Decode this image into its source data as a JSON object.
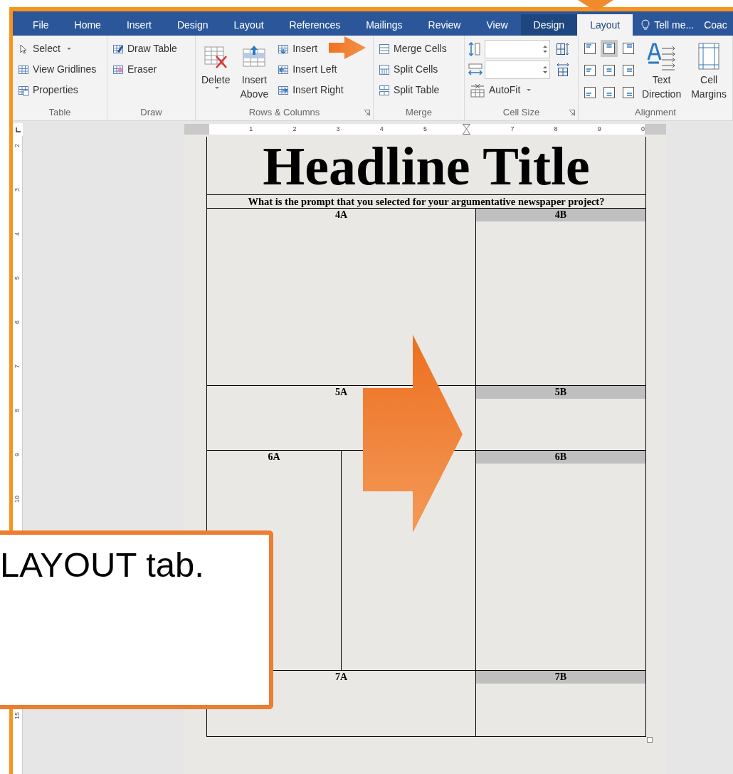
{
  "tabs": [
    {
      "label": "File",
      "selected": false,
      "contextual": false
    },
    {
      "label": "Home",
      "selected": false,
      "contextual": false
    },
    {
      "label": "Insert",
      "selected": false,
      "contextual": false
    },
    {
      "label": "Design",
      "selected": false,
      "contextual": false
    },
    {
      "label": "Layout",
      "selected": false,
      "contextual": false
    },
    {
      "label": "References",
      "selected": false,
      "contextual": false
    },
    {
      "label": "Mailings",
      "selected": false,
      "contextual": false
    },
    {
      "label": "Review",
      "selected": false,
      "contextual": false
    },
    {
      "label": "View",
      "selected": false,
      "contextual": false
    },
    {
      "label": "Design",
      "selected": false,
      "contextual": true
    },
    {
      "label": "Layout",
      "selected": true,
      "contextual": true
    }
  ],
  "tell_me": "Tell me...",
  "cut_tab": "Coac",
  "ribbon": {
    "groups": [
      {
        "label": "Table",
        "launcher": false,
        "columns": [
          [
            {
              "kind": "small",
              "label": "Select",
              "dropdown": true
            },
            {
              "kind": "small",
              "label": "View Gridlines",
              "dropdown": false
            },
            {
              "kind": "small",
              "label": "Properties",
              "dropdown": false
            }
          ]
        ]
      },
      {
        "label": "Draw",
        "launcher": false,
        "columns": [
          [
            {
              "kind": "small",
              "label": "Draw Table",
              "dropdown": false
            },
            {
              "kind": "small",
              "label": "Eraser",
              "dropdown": false
            }
          ]
        ]
      },
      {
        "label": "Rows & Columns",
        "launcher": true,
        "columns": [
          [
            {
              "kind": "large",
              "label": "Delete",
              "dropdown": true
            }
          ],
          [
            {
              "kind": "large",
              "label": "Insert Above",
              "dropdown": false
            }
          ],
          [
            {
              "kind": "small",
              "label": "Insert",
              "dropdown": false
            },
            {
              "kind": "small",
              "label": "Insert Left",
              "dropdown": false
            },
            {
              "kind": "small",
              "label": "Insert Right",
              "dropdown": false
            }
          ]
        ]
      },
      {
        "label": "Merge",
        "launcher": false,
        "columns": [
          [
            {
              "kind": "small",
              "label": "Merge Cells",
              "dropdown": false
            },
            {
              "kind": "small",
              "label": "Split Cells",
              "dropdown": false
            },
            {
              "kind": "small",
              "label": "Split Table",
              "dropdown": false
            }
          ]
        ]
      },
      {
        "label": "Cell Size",
        "launcher": true,
        "columns": [
          [
            {
              "kind": "spin"
            },
            {
              "kind": "spin"
            },
            {
              "kind": "small",
              "label": "AutoFit",
              "dropdown": true
            }
          ],
          [
            {
              "kind": "icon"
            },
            {
              "kind": "icon"
            }
          ]
        ]
      },
      {
        "label": "Alignment",
        "launcher": false,
        "columns": [
          [
            {
              "kind": "align",
              "cells": [
                {
                  "selected": false
                },
                {
                  "selected": true
                },
                {
                  "selected": false
                },
                {
                  "selected": false
                },
                {
                  "selected": false
                },
                {
                  "selected": false
                },
                {
                  "selected": false
                },
                {
                  "selected": false
                },
                {
                  "selected": false
                }
              ]
            }
          ],
          [
            {
              "kind": "large",
              "label": "Text Direction",
              "dropdown": false
            }
          ],
          [
            {
              "kind": "large",
              "label": "Cell Margins",
              "dropdown": false
            }
          ]
        ]
      }
    ]
  },
  "ruler": {
    "marks": [
      {
        "kind": "number",
        "label": "1"
      },
      {
        "kind": "number",
        "label": "2"
      },
      {
        "kind": "number",
        "label": "3"
      },
      {
        "kind": "number",
        "label": "4"
      },
      {
        "kind": "number",
        "label": "5"
      },
      {
        "kind": "marker"
      },
      {
        "kind": "number",
        "label": "7"
      },
      {
        "kind": "number",
        "label": "8"
      },
      {
        "kind": "number",
        "label": "9"
      },
      {
        "kind": "number",
        "label": "0"
      }
    ]
  },
  "vertical_ruler": {
    "marks": [
      "2",
      "3",
      "4",
      "5",
      "6",
      "7",
      "8",
      "9",
      "10"
    ],
    "end_mark": "15"
  },
  "document": {
    "headline": "Headline Title",
    "prompt": "What is the prompt that you selected for your argumentative newspaper project?",
    "rows": [
      {
        "cells": [
          {
            "label": "4A",
            "shaded": false,
            "split": false
          },
          {
            "label": "4B",
            "shaded": true,
            "split": false
          }
        ]
      },
      {
        "cells": [
          {
            "label": "5A",
            "shaded": false,
            "split": false
          },
          {
            "label": "5B",
            "shaded": true,
            "split": false
          }
        ]
      },
      {
        "cells": [
          {
            "label": "6A",
            "shaded": false,
            "split": true
          },
          {
            "label": "6B",
            "shaded": true,
            "split": false
          }
        ]
      },
      {
        "cells": [
          {
            "label": "7A",
            "shaded": false,
            "split": false
          },
          {
            "label": "7B",
            "shaded": true,
            "split": false
          }
        ]
      }
    ]
  },
  "callout": {
    "text": "LAYOUT tab."
  }
}
